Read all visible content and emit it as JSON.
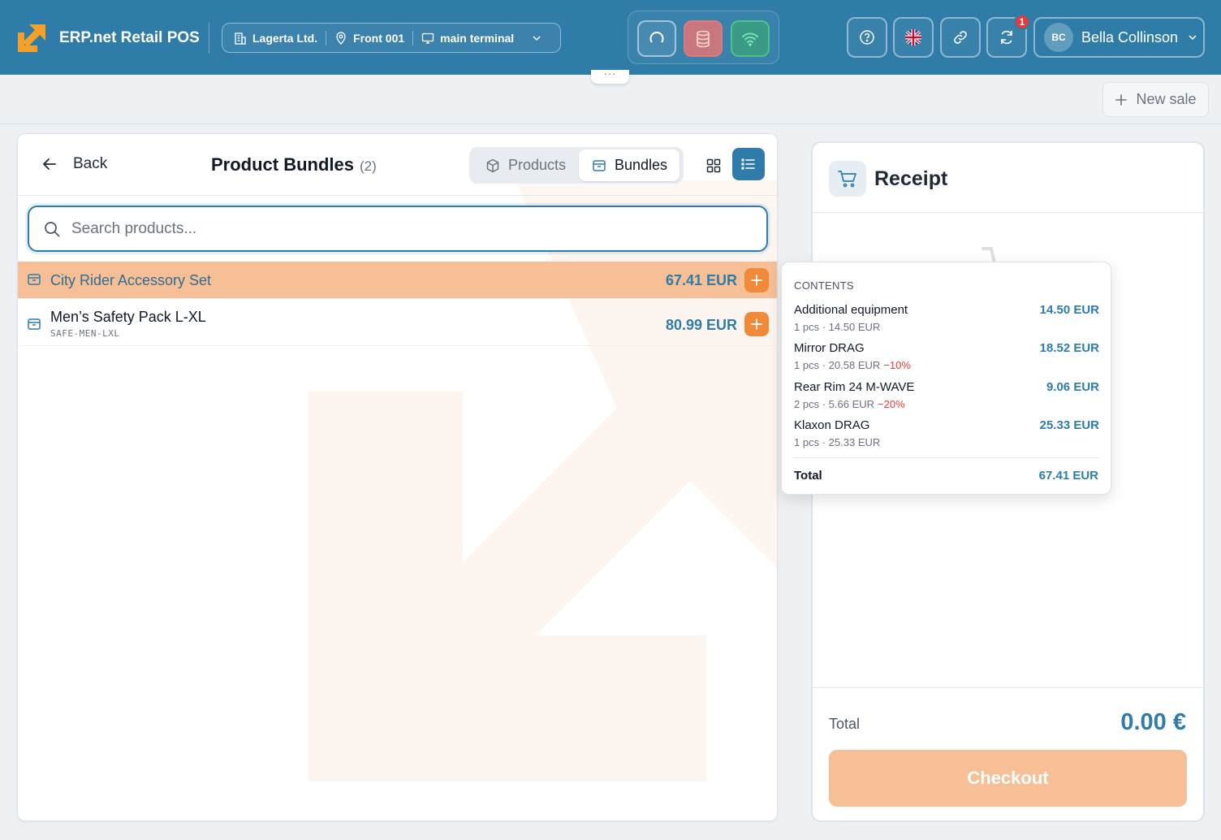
{
  "header": {
    "app_title": "ERP.net Retail POS",
    "company": "Lagerta Ltd.",
    "store": "Front 001",
    "terminal": "main terminal",
    "notification_count": "1",
    "user": {
      "initials": "BC",
      "name": "Bella Collinson"
    },
    "handle_glyph": "···"
  },
  "toolbar": {
    "new_sale_label": "New sale"
  },
  "catalog": {
    "back_label": "Back",
    "title": "Product Bundles",
    "count": "(2)",
    "tabs": [
      {
        "label": "Products",
        "icon": "cube-icon",
        "active": false
      },
      {
        "label": "Bundles",
        "icon": "package-icon",
        "active": true
      }
    ],
    "view_mode": "list",
    "search": {
      "placeholder": "Search products...",
      "value": ""
    },
    "items": [
      {
        "name": "City Rider Accessory Set",
        "sku": "",
        "price": "67.41 EUR",
        "highlighted": true
      },
      {
        "name": "Men’s Safety Pack L-XL",
        "sku": "SAFE-MEN-LXL",
        "price": "80.99 EUR",
        "highlighted": false
      }
    ]
  },
  "receipt": {
    "title": "Receipt",
    "total_label": "Total",
    "total_value": "0.00 €",
    "checkout_label": "Checkout"
  },
  "tooltip": {
    "heading": "CONTENTS",
    "items": [
      {
        "name": "Additional equipment",
        "qty": "1 pcs",
        "unit_price": "14.50 EUR",
        "discount": "",
        "price": "14.50 EUR"
      },
      {
        "name": "Mirror DRAG",
        "qty": "1 pcs",
        "unit_price": "20.58 EUR",
        "discount": "−10%",
        "price": "18.52 EUR"
      },
      {
        "name": "Rear Rim 24 M-WAVE",
        "qty": "2 pcs",
        "unit_price": "5.66 EUR",
        "discount": "−20%",
        "price": "9.06 EUR"
      },
      {
        "name": "Klaxon DRAG",
        "qty": "1 pcs",
        "unit_price": "25.33 EUR",
        "discount": "",
        "price": "25.33 EUR"
      }
    ],
    "separator": "·",
    "total_label": "Total",
    "total_value": "67.41 EUR"
  },
  "colors": {
    "header_bg": "#2f7ca8",
    "accent": "#2f7ca8",
    "highlight_row": "#f6bf96",
    "add_button": "#f08a3a",
    "discount": "#e23b3b"
  }
}
